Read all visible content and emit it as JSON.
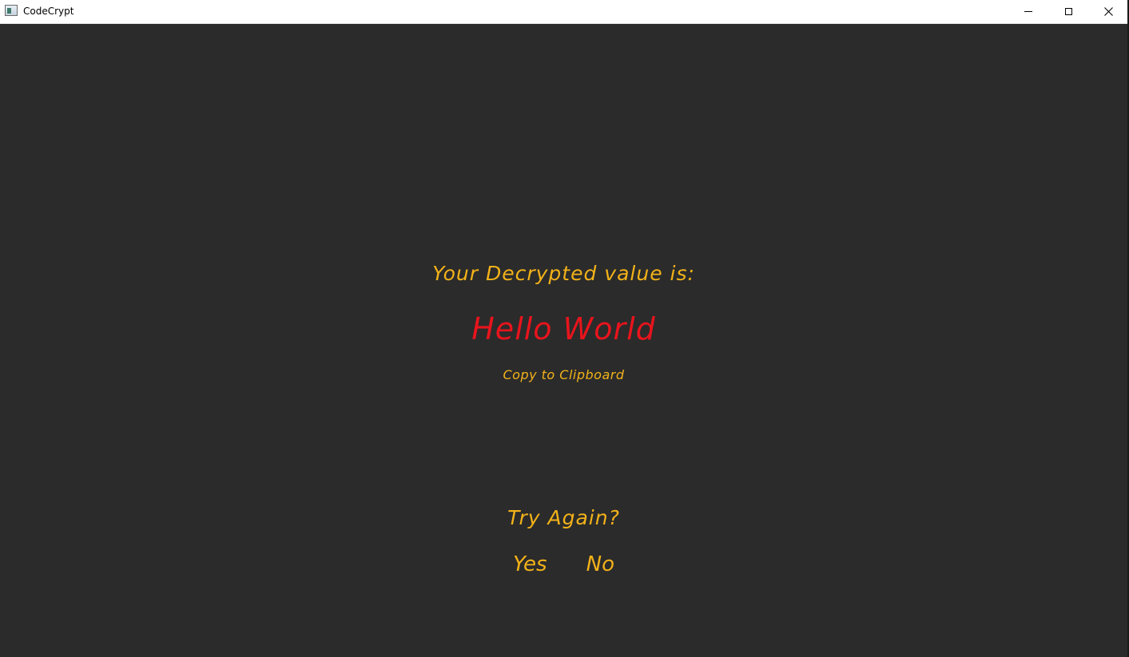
{
  "window": {
    "title": "CodeCrypt",
    "icon": "app-window-icon",
    "controls": {
      "minimize_icon": "minimize-icon",
      "maximize_icon": "maximize-icon",
      "close_glyph": "✕"
    }
  },
  "colors": {
    "background": "#2b2b2b",
    "accent": "#f3b219",
    "value": "#e8141c"
  },
  "result": {
    "prompt": "Your Decrypted value is:",
    "value": "Hello World",
    "copy_label": "Copy to Clipboard"
  },
  "retry": {
    "question": "Try Again?",
    "yes_label": "Yes",
    "no_label": "No"
  }
}
